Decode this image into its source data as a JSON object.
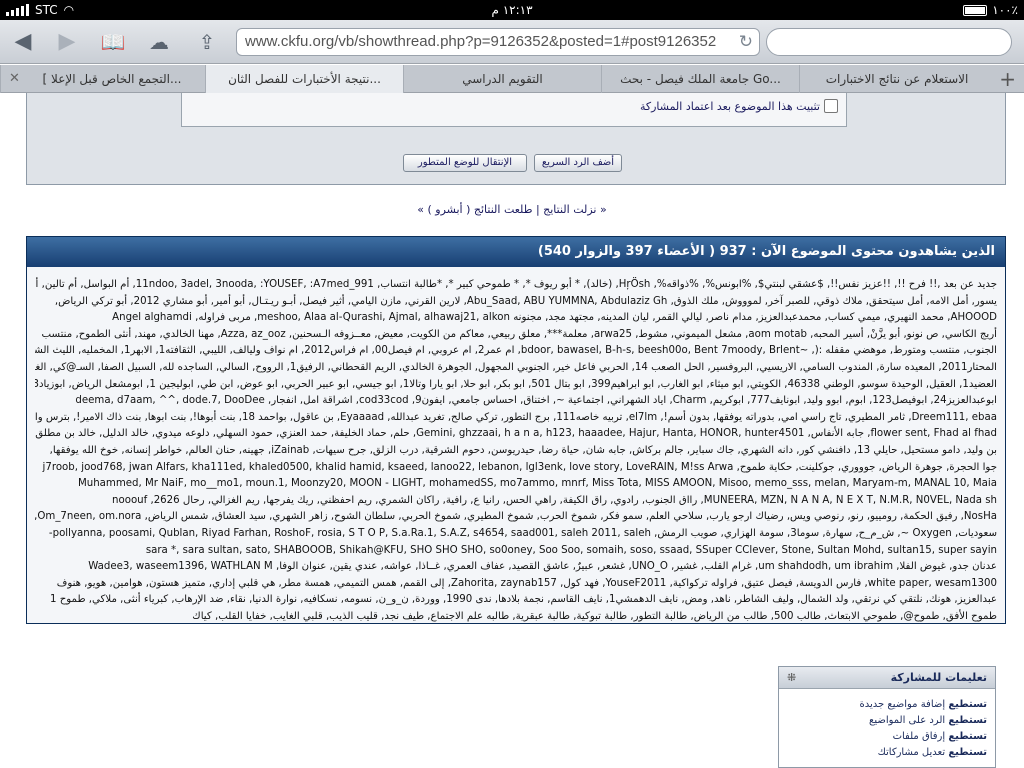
{
  "status_bar": {
    "carrier": "STC",
    "time": "١٢:١٣ م",
    "battery": "١٠٠٪"
  },
  "browser": {
    "url": "www.ckfu.org/vb/showthread.php?p=9126352&posted=1#post9126352",
    "tabs": [
      {
        "label": "[ التجمع الخاص قبل الإعلا...",
        "active": false
      },
      {
        "label": "نتيجة الأختبارات للفصل الثان...",
        "active": true
      },
      {
        "label": "التقويم الدراسي",
        "active": false
      },
      {
        "label": "جامعة الملك فيصل - بحث Go...",
        "active": false
      },
      {
        "label": "الاستعلام عن نتائج الاختبارات",
        "active": false
      }
    ]
  },
  "reply_area": {
    "pin_label": "تثبيت هذا الموضوع بعد اعتماد المشاركة",
    "quick_reply_button": "أضف الرد السريع",
    "advanced_button": "الإنتقال للوضع المتطور"
  },
  "thread_nav": {
    "text": "« نزلت النتايج | طلعت النتائج ( أبشرو ) »"
  },
  "viewers": {
    "title": "الذين يشاهدون محتوى الموضوع الآن : 937 ( الأعضاء 397 والزوار 540)",
    "lines": [
      "جديد عن بعد ,!! فرح !!, !!عزيز نفس!!, $عشقي لبنتي$, %ابونس%, %ذواقه%, HŗÖsh, (خالد), * أبو ريوف *, * طموحي كبير *, *طالبة انتساب, 11ndoo, 3adel, 3nooda, :YOUSEF, :A7med_991, أم البواسل, أم تالين, أم",
      "يسور, أمل الامه, أمل سيتحقق, ملاك ذوقي, للصبر آخر, لموووش, ملك الذوق, Abu_Saad, ABU YUMMNA, Abdulaziz Gh, لارين القرني, مازن اليامي, أثير فيصل, أبـو ريـتـال, أبو أمير, أبو مشاري 2012, أبو تركي الرياض,",
      "AHOOOD, محمد النهيري, ميمي كساب, محمدعبدالعزيز, مدام ناصر, ليالي القمر, ليان المدينه, مجتهد مجد, مجنونه meshoo, Alaa al-Qurashi, Ajmal, alhawaj21, alkon, مربى فراوله, Angel alghamdi",
      "أريج الكاسي, ص نونو, أبو يزَّنْ, أسير المحبه, aom motab, مشعل الميموني, مشوط, arwa25, معلمة***, معلق ربيعي, معاكم من الكويت, معيض, معــزوفه الـسحنين, Azza, az_ooz, مهنا الخالدي, مهند, أنثى الطموح, منتسب",
      "الجنوب, منتسب ومتورط, موهضي مقفله :(, ~bdoor, bawasel, B-h-s, beesh00o, Bent 7moody, Brlent, ام عمر2, ام عروبي, ام فيصل00, ام فراس2012, ام نواف وليالف, الليبي, الثقافته1, الابهر1, المخمليه, الليث الشبابي,",
      "المحتار2011, المعيده سارة, المندوب السامي, الاريسيي, البروفسير, الحل الصعب 14, الحربي فاعل خير, الجنوبي المجهول, الجوهرة الخالدي, الريم القحطاني, الرفيق1, الرووح, السالي, الساجده لله, السبيل الصفا, السـ@كي, الغاليييييه,",
      "العضيد1, العقيل, الوحيدة سوسو, الوطني 46338, الكويتي, ابو ميثاء, ابو الغارب, ابو ابراهيم399, ابو بتال 501, ابو بكر, ابو حلا, ابو يارا وتالا1, ابو جيسي, ابو عبير الحربي, ابو عوض, ابن طي, ابوليجين 1, ابومشعل الرياض, ابوزياد33,",
      "ابوعبدالعزيز24, ابوفيصل123, ابوم, ابوو وليد, ابونايف777, ابوكريم, Charm, اياد الشهراني, اجتماعية ~, اختناق, احساس جامعي, ايفون9, cod33cod, اشراقة امل, انفجار, deema, d7aam, ^^, dode.7, DooDee",
      "Dreem111, ebaa, ثامر المطيري, تاج راسي امي, بدوراته يوفقها, بدون أسم!, el7lm, تربيه خاصه111, برج التطور, تركي صالح, تغريد عبدالله, Eyaaaad, بن عاقول, بواحمد 18, بنت أبوها!, بنت ابوها, بنت ذاك الامير!, بترس واحد,",
      "flower sent, Fhad al fhad, جابه الأنفاس, Gemini, ghzzaai, h a n a, h123, haaadee, Hajur, Hanta, HONOR, hunter4501, حلم, حماد الخليفة, حمد العنزي, حمود السهلي, دلوعه ميدوي, خالد الدليل, خالد بن مطلق, خالد",
      "بن وليد, دامو مستحيل, حايلي 13, دافنشي كور, دانه الشهري, جاك سباير, جالم بركاش, جابه شان, حياة رضا, حيدريوسن, دحوم الشرقية, درب الزلق, جرح سيهات, iZainab, جهينه, حنان العالم, خواطر إنسانه, خوخ الله يوفقها,",
      "جوا الحجرة, جوهرة الرياض, جوووري, جوكلينت, حكاية طموح, j7roob, jood768, jwan Alfars, kha111ed, khaled0500, khalid hamid, ksaeed, lanoo22, lebanon, lgl3enk, love story, LoveRAIN, M!ss Arwa",
      "Muhammed, Mr NaiF, mo__mo1, moun.1, Moonzy20, MOON - LIGHT, mohamedSS, mo7ammo, mnrf, Miss Tota, MISS AMOON, Misoo, memo_sss, melan, Maryam-m, MANAL 10, Maia",
      "MUNEERA, MZN, N A N A, N E X T, N.M.R, N0VEL, Nada sh, رااق الجنوب, رادوي, راق الكيفة, راهي الحس, رانيا ع, رافية, راكان الشمري, ريم احفظني, ريك يفرجها, ريم الغزالي, رحال 2626, nooouf",
      "NosHa, رفيق الحكمة, رومييو, رنو, رنوصي ويس, رضياك ارجو يارب, سلاحي العلم, سمو فكر, شموخ الحرب, شموخ المطيري, شموخ الحربي, سلطان الشوح, زاهر الشهري, سيد العشاق, شمس الرياض, Om_7neen, om.nora, صَمْتْ مُؤْلِمْ,",
      "سعوديات, Oxygen ~, ش_م_ح, سهارة, سوما3, سومة الهزاري, صويب الرمش, pollyanna, poosami, Qublan, Riyad Farhan, RoshoF, rosia, S T O P, S.a.Ra.1, S.A.Z, s4654, saad001, saleh 2011, saleh-",
      "sara *, sara sultan, sato, SHABOOOB, Shikah@KFU, SHO SHO SHO, so0oney, Soo Soo, somaih, soso, ssaad, SSuper CClever, Stone, Sultan Mohd, sultan15, super sayin",
      "عدنان جدو, غيوض الفلا, um shahdodh, um ibrahim, غرام القلب, غشير, UNO_O, غشعر, عبيرٌ, عاشق القصيد, عفاف العمري, غــاذا, عواشه, عندي يقين, عنوان الوفا, Wadee3, waseem1396, WATHLAN M",
      "white paper, wesam1300, فارس الدويسة, فيصل عتيق, فراوله تركواكية, YouseF2011, فهد كول, Zahorita, zaynab157, إلى القمم, همس التميمي, همسة مطر, هي قلبي إداري, متميز هستون, هوامين, هويو, هنوف",
      "عبدالعزيز, هونك, نلتقي كي نرتقي, ولد الشمال, وليف الشاطر, ناهد, ومض, نايف الدهمشي1, نايف القاسم, نجمة بلادها, ندى 1990, ووردة, ن_و_ن, نسومه, نسكافيه, نوارة الدنيا, نقاء, ضد الإرهاب, كبرياء أنثى, ملاكي, طموح 1",
      "طموح الأفق, طموح@, طموحي الابتعاث, طالب 500, طالب من الرياض, طالبة التطور, طالبة تبوكية, طالبة عبقرية, طالبه علم الاجتماع, طيف نجد, قليب الذيب, قلبي الغايب, خفايا القلب, كياك"
    ]
  },
  "permissions": {
    "title": "تعليمات للمشاركة",
    "items": [
      {
        "strong": "تستطيع",
        "rest": " إضافة مواضيع جديدة"
      },
      {
        "strong": "تستطيع",
        "rest": " الرد على المواضيع"
      },
      {
        "strong": "تستطيع",
        "rest": " إرفاق ملفات"
      },
      {
        "strong": "تستطيع",
        "rest": " تعديل مشاركاتك"
      }
    ]
  },
  "colors": {
    "header_blue": "#183f72",
    "link_navy": "#1a1a5e",
    "highlight_orange": "#e07a1a",
    "highlight_purple": "#a020a0"
  }
}
